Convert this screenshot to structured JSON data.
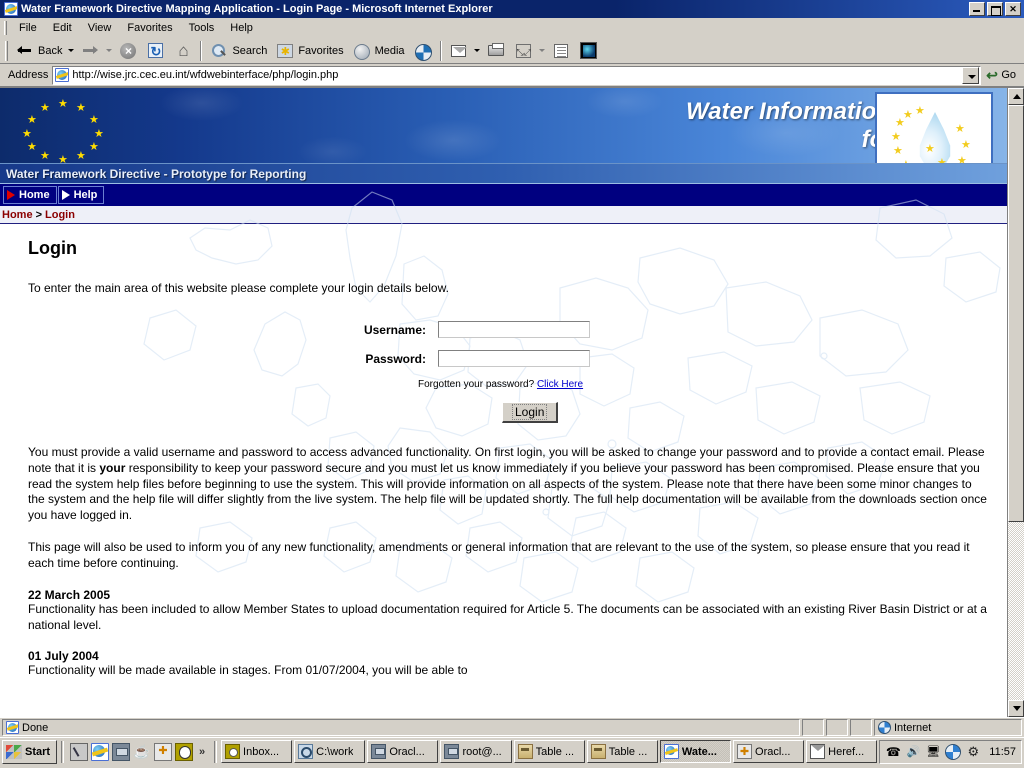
{
  "window": {
    "title": "Water Framework Directive Mapping Application - Login Page - Microsoft Internet Explorer",
    "icon": "ie-document-icon",
    "minimize_label": "",
    "restore_label": "",
    "close_label": "✕"
  },
  "menu": {
    "items": [
      {
        "label": "File"
      },
      {
        "label": "Edit"
      },
      {
        "label": "View"
      },
      {
        "label": "Favorites"
      },
      {
        "label": "Tools"
      },
      {
        "label": "Help"
      }
    ]
  },
  "toolbar": {
    "back_label": "Back",
    "forward_label": "",
    "stop_label": "",
    "refresh_label": "",
    "home_label": "",
    "search_label": "Search",
    "favorites_label": "Favorites",
    "media_label": "Media",
    "history_label": "",
    "mail_label": "",
    "print_label": "",
    "fullscreen_label": "",
    "edit_label": "",
    "discuss_label": ""
  },
  "address": {
    "label": "Address",
    "url": "http://wise.jrc.cec.eu.int/wfdwebinterface/php/login.php",
    "placeholder": "",
    "go_label": "Go"
  },
  "banner": {
    "title_line1": "Water Information System",
    "title_line2": "for Europe",
    "subtitle": "Water Framework Directive - Prototype for Reporting",
    "logo_alt": "water-droplet-eu-stars-logo"
  },
  "nav": {
    "items": [
      {
        "label": "Home",
        "icon": "play-triangle-red-icon"
      },
      {
        "label": "Help",
        "icon": "play-triangle-white-icon"
      }
    ]
  },
  "breadcrumb": {
    "home": "Home",
    "separator": ">",
    "current": "Login"
  },
  "page": {
    "title": "Login",
    "intro": "To enter the main area of this website please complete your login details below."
  },
  "login_form": {
    "username_label": "Username:",
    "username_value": "",
    "password_label": "Password:",
    "password_value": "",
    "forgotten_text": "Forgotten your password?",
    "forgotten_link": "Click Here",
    "submit_label": "Login"
  },
  "notices": {
    "paragraph1_part1": "You must provide a valid username and password to access advanced functionality. On first login, you will be asked to change your password and to provide a contact email. Please note that it is ",
    "paragraph1_bold": "your",
    "paragraph1_part2": " responsibility to keep your password secure and you must let us know immediately if you believe your password has been compromised. Please ensure that you read the system help files before beginning to use the system. This will provide information on all aspects of the system. Please note that there have been some minor changes to the system and the help file will differ slightly from the live system. The help file will be updated shortly. The full help documentation will be available from the downloads section once you have logged in.",
    "paragraph2": "This page will also be used to inform you of any new functionality, amendments or general information that are relevant to the use of the system, so please ensure that you read it each time before continuing.",
    "entries": [
      {
        "date": "22 March 2005",
        "body": "Functionality has been included to allow Member States to upload documentation required for Article 5. The documents can be associated with an existing River Basin District or at a national level."
      },
      {
        "date": "01 July 2004",
        "body": "Functionality will be made available in stages. From 01/07/2004, you will be able to"
      }
    ]
  },
  "statusbar": {
    "status": "Done",
    "zone": "Internet"
  },
  "taskbar": {
    "start_label": "Start",
    "quick_launch": [
      {
        "icon": "show-desktop-icon"
      },
      {
        "icon": "internet-explorer-icon"
      },
      {
        "icon": "network-icon"
      },
      {
        "icon": "coffee-icon"
      },
      {
        "icon": "oracle-icon"
      },
      {
        "icon": "clock-app-icon"
      }
    ],
    "more_label": "»",
    "tasks": [
      {
        "label": "Inbox...",
        "icon": "outlook-icon",
        "active": false
      },
      {
        "label": "C:\\work",
        "icon": "folder-search-icon",
        "active": false
      },
      {
        "label": "Oracl...",
        "icon": "oracle-icon",
        "active": false
      },
      {
        "label": "root@...",
        "icon": "terminal-icon",
        "active": false
      },
      {
        "label": "Table ...",
        "icon": "table-icon",
        "active": false
      },
      {
        "label": "Table ...",
        "icon": "table-icon",
        "active": false
      },
      {
        "label": "Wate...",
        "icon": "internet-explorer-icon",
        "active": true
      },
      {
        "label": "Oracl...",
        "icon": "oracle-icon",
        "active": false
      },
      {
        "label": "Heref...",
        "icon": "mail-icon",
        "active": false
      }
    ],
    "tray_icons": [
      {
        "icon": "phone-icon"
      },
      {
        "icon": "volume-icon"
      },
      {
        "icon": "network-connection-icon"
      },
      {
        "icon": "globe-icon"
      },
      {
        "icon": "utility-icon"
      }
    ],
    "clock": "11:57"
  },
  "colors": {
    "titlebar_blue": "#0a246a",
    "banner_dark_blue": "#0d2b6b",
    "banner_light_blue": "#86b4e8",
    "navbar_navy": "#000080",
    "breadcrumb_red": "#8b0000",
    "link_blue": "#0000cc",
    "chrome_grey": "#d4d0c8",
    "star_yellow": "#ffdd00"
  }
}
